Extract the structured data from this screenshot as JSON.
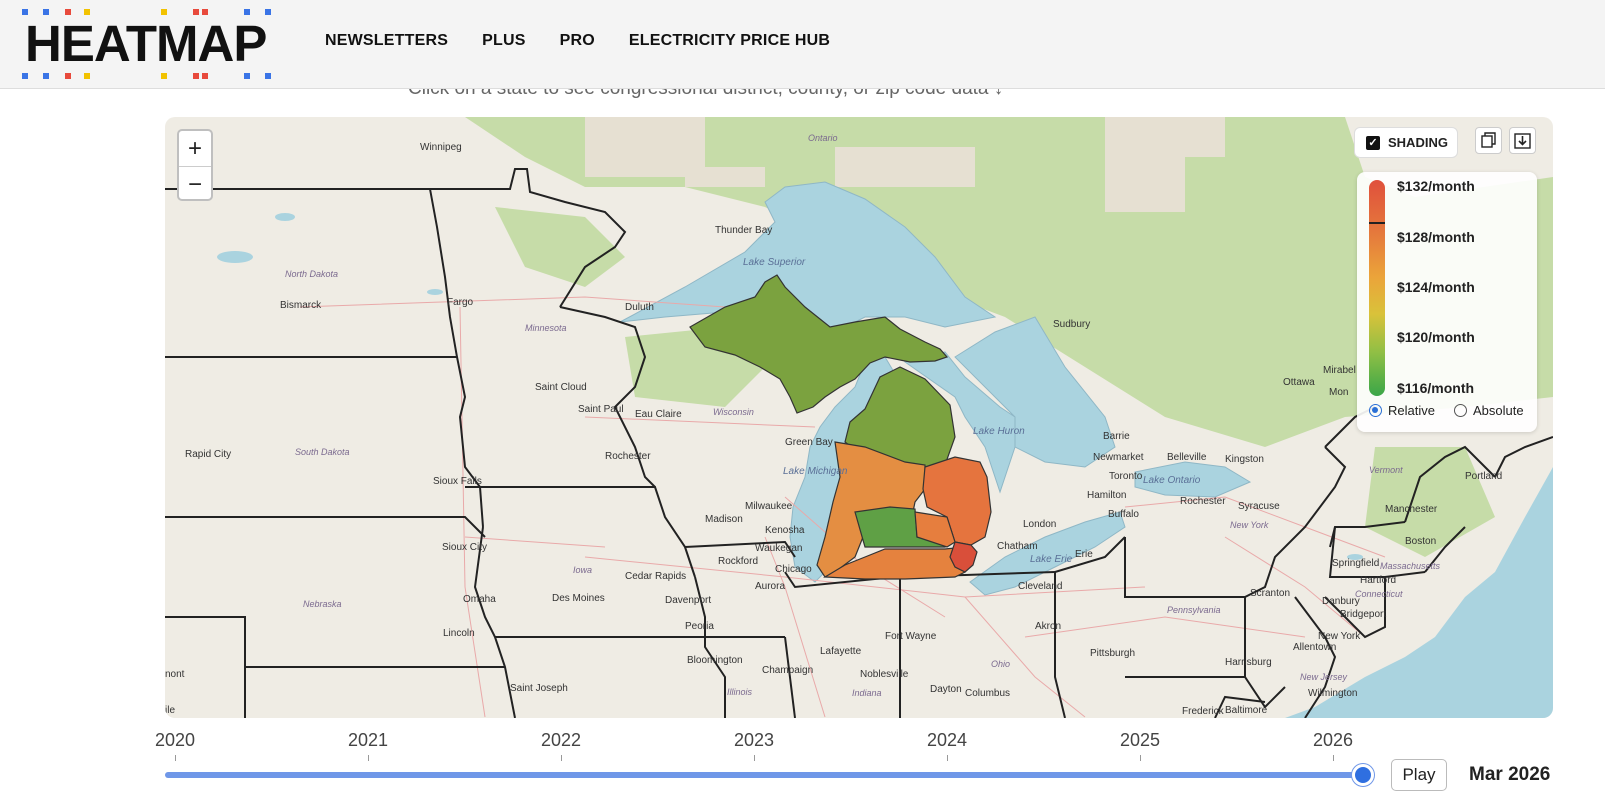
{
  "header": {
    "logo_text": "HEATMAP",
    "nav": [
      "NEWSLETTERS",
      "PLUS",
      "PRO",
      "ELECTRICITY PRICE HUB"
    ]
  },
  "subtitle": "Click on a state to see congressional district, county, or zip code data ↓",
  "map": {
    "zoom_in": "+",
    "zoom_out": "−",
    "shading_label": "SHADING",
    "shading_checked": true,
    "legend": {
      "labels": [
        "$132/month",
        "$128/month",
        "$124/month",
        "$120/month",
        "$116/month"
      ],
      "current_value": 130.5,
      "modes": [
        "Relative",
        "Absolute"
      ],
      "selected_mode": "Relative",
      "colors": {
        "high": "#e0503c",
        "mid": "#eba43a",
        "low": "#3aa648"
      }
    },
    "places": {
      "winnipeg": "Winnipeg",
      "ontario": "Ontario",
      "thunder_bay": "Thunder Bay",
      "lake_superior": "Lake Superior",
      "north_dakota": "North Dakota",
      "bismarck": "Bismarck",
      "fargo": "Fargo",
      "duluth": "Duluth",
      "minnesota": "Minnesota",
      "sudbury": "Sudbury",
      "saint_cloud": "Saint Cloud",
      "saint_paul": "Saint Paul",
      "eau_claire": "Eau Claire",
      "wisconsin": "Wisconsin",
      "ottawa": "Ottawa",
      "mirabel": "Mirabel",
      "montreal": "Mon",
      "rapid_city": "Rapid City",
      "south_dakota": "South Dakota",
      "rochester_mn": "Rochester",
      "green_bay": "Green Bay",
      "lake_huron": "Lake Huron",
      "barrie": "Barrie",
      "newmarket": "Newmarket",
      "belleville": "Belleville",
      "kingston": "Kingston",
      "vermont": "Vermont",
      "toronto": "Toronto",
      "lake_michigan": "Lake Michigan",
      "lake_ontario": "Lake Ontario",
      "sioux_falls": "Sioux Falls",
      "hamilton": "Hamilton",
      "rochester_ny": "Rochester",
      "syracuse": "Syracuse",
      "portland": "Portland",
      "milwaukee": "Milwaukee",
      "buffalo": "Buffalo",
      "manchester": "Manchester",
      "madison": "Madison",
      "london": "London",
      "new_york_state": "New York",
      "kenosha": "Kenosha",
      "sioux_city": "Sioux City",
      "waukegan": "Waukegan",
      "chatham": "Chatham",
      "boston": "Boston",
      "lake_erie": "Lake Erie",
      "erie": "Erie",
      "rockford": "Rockford",
      "chicago": "Chicago",
      "iowa": "Iowa",
      "springfield": "Springfield",
      "massachusetts": "Massachusetts",
      "cedar_rapids": "Cedar Rapids",
      "hartford": "Hartford",
      "des_moines": "Des Moines",
      "omaha": "Omaha",
      "davenport": "Davenport",
      "aurora": "Aurora",
      "cleveland": "Cleveland",
      "scranton": "Scranton",
      "connecticut": "Connecticut",
      "danbury": "Danbury",
      "bridgeport": "Bridgeport",
      "nebraska": "Nebraska",
      "pennsylvania": "Pennsylvania",
      "lincoln": "Lincoln",
      "fort_wayne": "Fort Wayne",
      "akron": "Akron",
      "allentown": "Allentown",
      "new_york_city": "New York",
      "peoria": "Peoria",
      "lafayette": "Lafayette",
      "pittsburgh": "Pittsburgh",
      "harrisburg": "Harrisburg",
      "bloomington": "Bloomington",
      "ohio": "Ohio",
      "champaign": "Champaign",
      "noblesville": "Noblesville",
      "new_jersey": "New Jersey",
      "saint_joseph": "Saint Joseph",
      "dayton": "Dayton",
      "wilmington": "Wilmington",
      "columbus": "Columbus",
      "illinois": "Illinois",
      "indiana": "Indiana",
      "frederick": "Frederick",
      "baltimore": "Baltimore",
      "kansas_partial": "nont",
      "kansas_partial2": "ile"
    }
  },
  "timeline": {
    "years": [
      "2020",
      "2021",
      "2022",
      "2023",
      "2024",
      "2025",
      "2026"
    ],
    "play_label": "Play",
    "current_date": "Mar 2026",
    "progress": 0.986
  }
}
